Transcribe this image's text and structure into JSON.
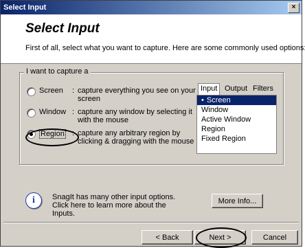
{
  "window": {
    "title": "Select Input",
    "close": "×"
  },
  "header": {
    "title": "Select Input",
    "subtitle": "First of all, select what you want to capture.  Here are some commonly used options:"
  },
  "group": {
    "label": "I want to capture a",
    "options": [
      {
        "label": "Screen",
        "desc": "capture everything you see on your screen",
        "selected": false
      },
      {
        "label": "Window",
        "desc": "capture any window by selecting it with the mouse",
        "selected": false
      },
      {
        "label": "Region",
        "desc": "capture any arbitrary region by clicking & dragging with the mouse",
        "selected": true
      }
    ]
  },
  "tabs": {
    "items": [
      "Input",
      "Output",
      "Filters"
    ],
    "active": "Input"
  },
  "input_list": [
    "Screen",
    "Window",
    "Active Window",
    "Region",
    "Fixed Region"
  ],
  "info": {
    "text": "SnagIt has many other input options.  Click here to learn more about the Inputs.",
    "more_button": "More Info..."
  },
  "footer": {
    "back": "< Back",
    "next": "Next >",
    "cancel": "Cancel"
  }
}
